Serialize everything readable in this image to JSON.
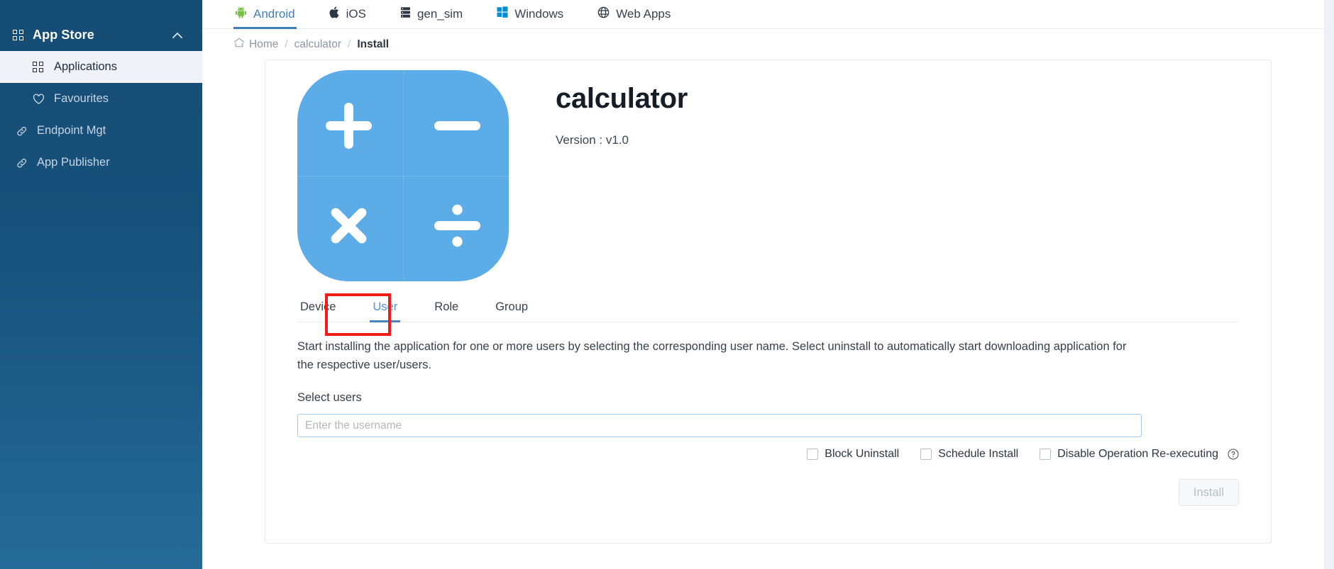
{
  "sidebar": {
    "group": {
      "label": "App Store",
      "icon": "grid-icon",
      "chevron": "chevron-up-icon"
    },
    "items": [
      {
        "label": "Applications",
        "icon": "grid-icon",
        "active": true
      },
      {
        "label": "Favourites",
        "icon": "heart-icon",
        "active": false
      },
      {
        "label": "Endpoint Mgt",
        "icon": "link-icon",
        "active": false
      },
      {
        "label": "App Publisher",
        "icon": "link-icon",
        "active": false
      }
    ]
  },
  "platform_tabs": [
    {
      "label": "Android",
      "icon": "android-icon",
      "active": true
    },
    {
      "label": "iOS",
      "icon": "apple-icon",
      "active": false
    },
    {
      "label": "gen_sim",
      "icon": "server-icon",
      "active": false
    },
    {
      "label": "Windows",
      "icon": "windows-icon",
      "active": false
    },
    {
      "label": "Web Apps",
      "icon": "globe-icon",
      "active": false
    }
  ],
  "breadcrumb": {
    "home": "Home",
    "app": "calculator",
    "current": "Install",
    "separator": "/"
  },
  "app": {
    "name": "calculator",
    "version_label": "Version : v1.0",
    "icon_color": "#5cace8",
    "icon_operators": [
      "plus",
      "minus",
      "times",
      "divide"
    ]
  },
  "target_tabs": [
    {
      "label": "Device",
      "active": false
    },
    {
      "label": "User",
      "active": true
    },
    {
      "label": "Role",
      "active": false
    },
    {
      "label": "Group",
      "active": false
    }
  ],
  "highlight": {
    "color": "#f21b1b",
    "target": "User"
  },
  "install_panel": {
    "description": "Start installing the application for one or more users by selecting the corresponding user name. Select uninstall to automatically start downloading application for the respective user/users.",
    "select_label": "Select users",
    "input": {
      "value": "",
      "placeholder": "Enter the username"
    },
    "options": [
      {
        "label": "Block Uninstall",
        "checked": false
      },
      {
        "label": "Schedule Install",
        "checked": false
      },
      {
        "label": "Disable Operation Re-executing",
        "checked": false,
        "help": true
      }
    ],
    "submit_label": "Install"
  },
  "colors": {
    "sidebar_top": "#154c74",
    "sidebar_bottom": "#256b98",
    "accent": "#3e7fbb",
    "highlight": "#f21b1b",
    "app_icon": "#5cace8"
  }
}
